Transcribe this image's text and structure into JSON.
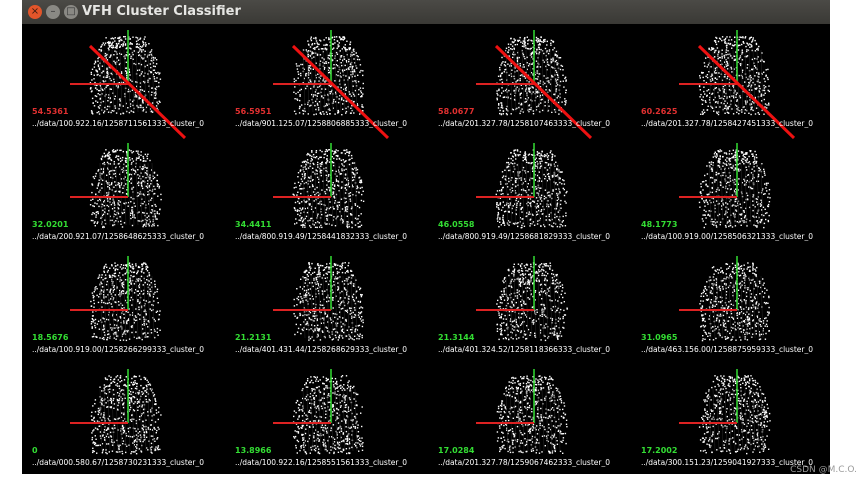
{
  "window": {
    "title": "VFH Cluster Classifier"
  },
  "titlebar_buttons": [
    "×",
    "–",
    "□"
  ],
  "cells": [
    {
      "score": "54.5361",
      "file": "../data/100.922.16/1258711561333_cluster_0",
      "color": "#e03030"
    },
    {
      "score": "56.5951",
      "file": "../data/901.125.07/1258806885333_cluster_0",
      "color": "#e03030"
    },
    {
      "score": "58.0677",
      "file": "../data/201.327.78/1258107463333_cluster_0",
      "color": "#e03030"
    },
    {
      "score": "60.2625",
      "file": "../data/201.327.78/1258427451333_cluster_0",
      "color": "#e03030"
    },
    {
      "score": "32.0201",
      "file": "../data/200.921.07/1258648625333_cluster_0",
      "color": "#33dd33"
    },
    {
      "score": "34.4411",
      "file": "../data/800.919.49/1258441832333_cluster_0",
      "color": "#33dd33"
    },
    {
      "score": "46.0558",
      "file": "../data/800.919.49/1258681829333_cluster_0",
      "color": "#33dd33"
    },
    {
      "score": "48.1773",
      "file": "../data/100.919.00/1258506321333_cluster_0",
      "color": "#33dd33"
    },
    {
      "score": "18.5676",
      "file": "../data/100.919.00/1258266299333_cluster_0",
      "color": "#33dd33"
    },
    {
      "score": "21.2131",
      "file": "../data/401.431.44/1258268629333_cluster_0",
      "color": "#33dd33"
    },
    {
      "score": "21.3144",
      "file": "../data/401.324.52/1258118366333_cluster_0",
      "color": "#33dd33"
    },
    {
      "score": "31.0965",
      "file": "../data/463.156.00/1258875959333_cluster_0",
      "color": "#33dd33"
    },
    {
      "score": "0",
      "file": "../data/000.580.67/1258730231333_cluster_0",
      "color": "#33dd33"
    },
    {
      "score": "13.8966",
      "file": "../data/100.922.16/1258551561333_cluster_0",
      "color": "#33dd33"
    },
    {
      "score": "17.0284",
      "file": "../data/201.327.78/1259067462333_cluster_0",
      "color": "#33dd33"
    },
    {
      "score": "17.2002",
      "file": "../data/300.151.23/1259041927333_cluster_0",
      "color": "#33dd33"
    }
  ],
  "watermark": "CSDN @M.C.O."
}
